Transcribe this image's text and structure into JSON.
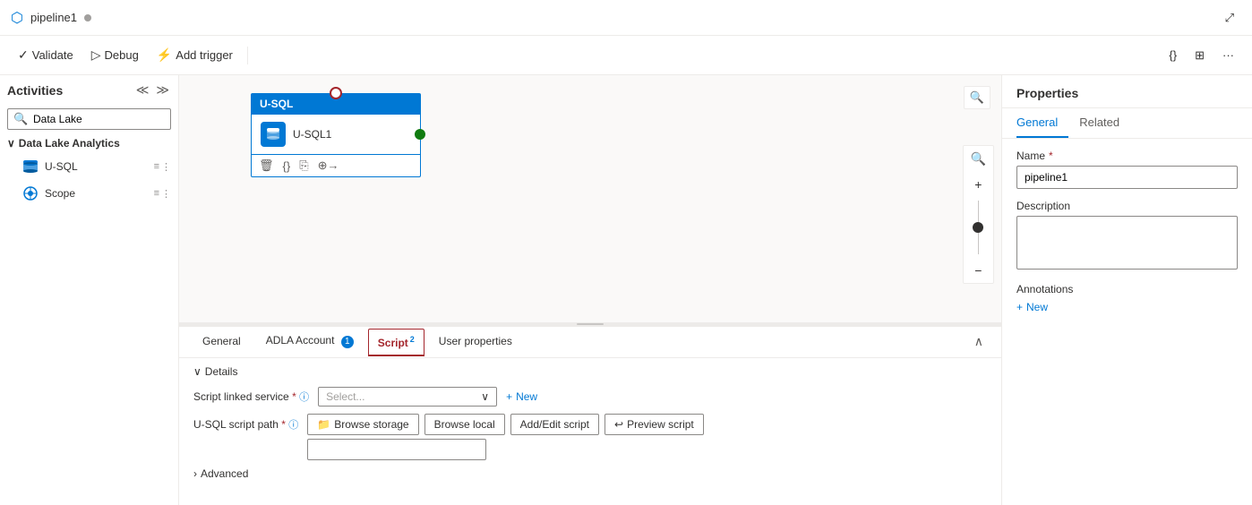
{
  "app": {
    "pipeline_name": "pipeline1",
    "window_icon": "⬡"
  },
  "toolbar": {
    "validate_label": "Validate",
    "debug_label": "Debug",
    "add_trigger_label": "Add trigger",
    "code_icon": "{}",
    "template_icon": "⊞",
    "more_icon": "···",
    "expand_icon": "⤢"
  },
  "sidebar": {
    "title": "Activities",
    "collapse_icon": "≪",
    "toggle_icon": "≫",
    "search_placeholder": "Data Lake",
    "category": "Data Lake Analytics",
    "items": [
      {
        "label": "U-SQL",
        "icon": "🗄"
      },
      {
        "label": "Scope",
        "icon": "⚙"
      }
    ]
  },
  "canvas": {
    "node": {
      "type": "U-SQL",
      "name": "U-SQL1"
    }
  },
  "bottom_panel": {
    "tabs": [
      {
        "label": "General",
        "active": false,
        "badge": null
      },
      {
        "label": "ADLA Account",
        "active": false,
        "badge": "1"
      },
      {
        "label": "Script",
        "active": true,
        "badge": "2"
      },
      {
        "label": "User properties",
        "active": false,
        "badge": null
      }
    ],
    "details_label": "Details",
    "script_linked_service_label": "Script linked service",
    "script_linked_service_placeholder": "Select...",
    "new_label": "New",
    "usql_path_label": "U-SQL script path",
    "browse_storage_label": "Browse storage",
    "browse_local_label": "Browse local",
    "add_edit_label": "Add/Edit script",
    "preview_script_label": "Preview script",
    "advanced_label": "Advanced"
  },
  "properties": {
    "title": "Properties",
    "tabs": [
      {
        "label": "General",
        "active": true
      },
      {
        "label": "Related",
        "active": false
      }
    ],
    "name_label": "Name",
    "name_value": "pipeline1",
    "description_label": "Description",
    "description_value": "",
    "annotations_label": "Annotations",
    "new_annotation_label": "New"
  }
}
